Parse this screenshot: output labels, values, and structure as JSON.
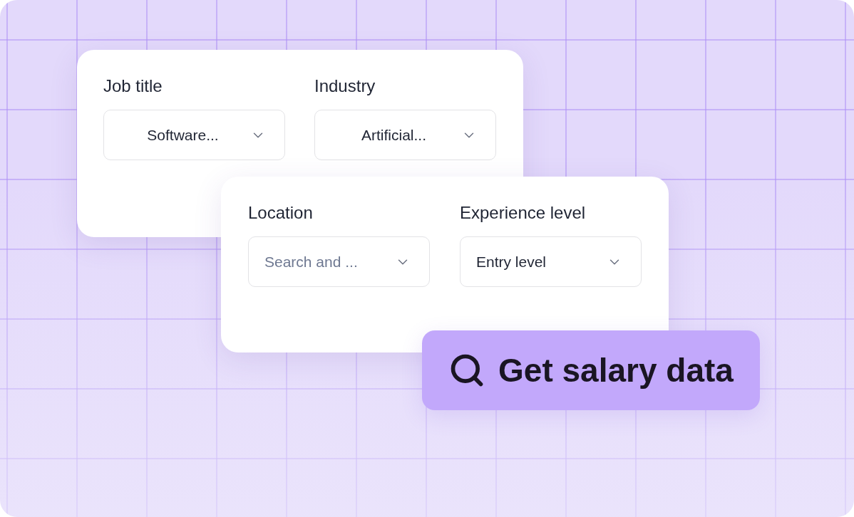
{
  "cards": [
    {
      "fields": [
        {
          "label": "Job title",
          "value": "Software..."
        },
        {
          "label": "Industry",
          "value": "Artificial..."
        }
      ]
    },
    {
      "fields": [
        {
          "label": "Location",
          "placeholder": "Search and ..."
        },
        {
          "label": "Experience level",
          "value": "Entry level"
        }
      ]
    }
  ],
  "button": {
    "label": "Get salary data"
  }
}
